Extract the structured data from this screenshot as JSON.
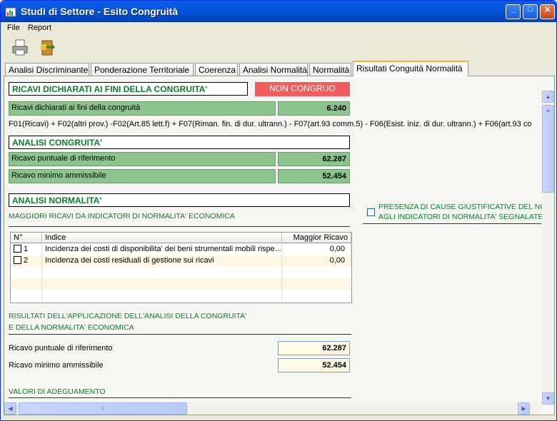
{
  "window": {
    "title": "Studi di Settore - Esito Congruità"
  },
  "menu": {
    "file": "File",
    "report": "Report"
  },
  "toolbar": {
    "print_icon": "printer-icon",
    "exit_icon": "exit-door-icon"
  },
  "tabs": [
    "Analisi Discriminante",
    "Ponderazione Territoriale",
    "Coerenza",
    "Analisi Normalità",
    "Normalità",
    "Risultati Conguità Normalità"
  ],
  "ricavi": {
    "header": "RICAVI DICHIARATI AI FINI DELLA CONGRUITA'",
    "status": "NON CONGRUO",
    "status_color": "#f25c5c",
    "label": "Ricavi dichiarati ai fini della congruità",
    "value": "6.240",
    "formula": "F01(Ricavi) + F02(altri prov.) -F02(Art.85 lett.f) + F07(Riman. fin. di dur. ultrann.) - F07(art.93 comm.5) - F06(Esist. iniz. di dur. ultrann.) + F06(art.93 co"
  },
  "congruita": {
    "header": "ANALISI CONGRUITA'",
    "puntuale_label": "Ricavo puntuale di riferimento",
    "puntuale_value": "62.287",
    "minimo_label": "Ricavo minimo ammissibile",
    "minimo_value": "52.454"
  },
  "normalita": {
    "header": "ANALISI NORMALITA'",
    "subtitle": "MAGGIORI RICAVI DA INDICATORI DI NORMALITA' ECONOMICA",
    "cause_line1": "PRESENZA DI CAUSE GIUSTIFICATIVE DEL NON",
    "cause_line2": "AGLI INDICATORI DI NORMALITA' SEGNALATE"
  },
  "table": {
    "col_n": "N°",
    "col_indice": "Indice",
    "col_ricavo": "Maggior Ricavo",
    "rows": [
      {
        "n": "1",
        "indice": "Incidenza dei costi di disponibilita' dei beni strumentali mobili rispe…",
        "ricavo": "0,00"
      },
      {
        "n": "2",
        "indice": "Incidenza dei costi residuali di gestione sui ricavi",
        "ricavo": "0,00"
      }
    ]
  },
  "risultati": {
    "title1": "RISULTATI DELL'APPLICAZIONE DELL'ANALISI DELLA CONGRUITA'",
    "title2": "E DELLA NORMALITA' ECONOMICA",
    "puntuale_label": "Ricavo puntuale di riferimento",
    "puntuale_value": "62.287",
    "minimo_label": "Ricavo minimo ammissibile",
    "minimo_value": "52.454"
  },
  "adeguamento": {
    "title": "VALORI DI ADEGUAMENTO"
  }
}
